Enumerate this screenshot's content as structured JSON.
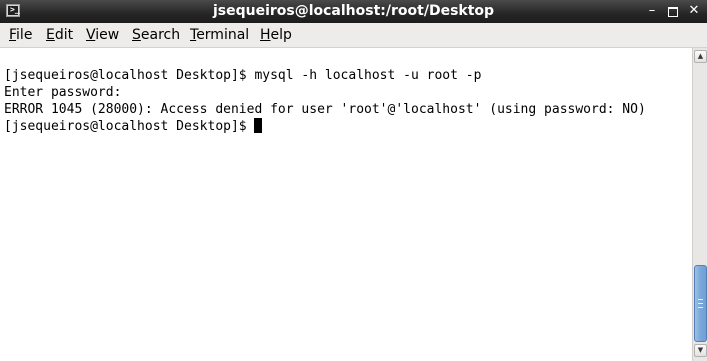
{
  "window": {
    "title": "jsequeiros@localhost:/root/Desktop",
    "app_icon": "terminal-icon",
    "controls": {
      "minimize": "–",
      "close": "✕"
    }
  },
  "menubar": {
    "file_rest": "ile",
    "file_accel": "F",
    "edit_rest": "dit",
    "edit_accel": "E",
    "view_rest": "iew",
    "view_accel": "V",
    "search_rest": "earch",
    "search_accel": "S",
    "terminal_rest": "erminal",
    "terminal_accel": "T",
    "help_rest": "elp",
    "help_accel": "H"
  },
  "terminal": {
    "lines": [
      "[jsequeiros@localhost Desktop]$ mysql -h localhost -u root -p",
      "Enter password:",
      "ERROR 1045 (28000): Access denied for user 'root'@'localhost' (using password: NO)",
      "[jsequeiros@localhost Desktop]$ "
    ],
    "background": "#ffffff",
    "foreground": "#000000"
  },
  "scrollbar": {
    "up_arrow": "▲",
    "down_arrow": "▼",
    "position": 1.0,
    "thumb_color": "#7aa7d8"
  }
}
